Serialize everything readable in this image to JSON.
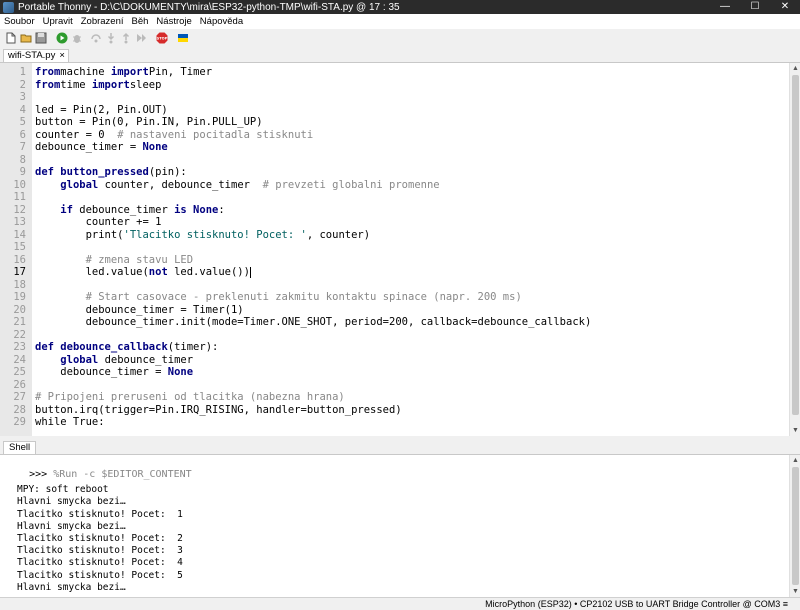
{
  "window": {
    "title": "Portable Thonny  -  D:\\C\\DOKUMENTY\\mira\\ESP32-python-TMP\\wifi-STA.py  @  17 : 35"
  },
  "window_buttons": {
    "minimize": "—",
    "maximize": "☐",
    "close": "✕"
  },
  "menu": [
    "Soubor",
    "Upravit",
    "Zobrazení",
    "Běh",
    "Nástroje",
    "Nápověda"
  ],
  "toolbar": {
    "icons": [
      "new-file-icon",
      "open-file-icon",
      "save-icon",
      "run-icon",
      "debug-icon",
      "step-over-icon",
      "step-into-icon",
      "step-out-icon",
      "resume-icon",
      "stop-icon",
      "ukraine-flag-icon"
    ],
    "colors": {
      "run": "#2e9b2e",
      "stop": "#d62b2b",
      "flag_blue": "#0057b7",
      "flag_yellow": "#ffd700"
    }
  },
  "editor": {
    "tab_label": "wifi-STA.py",
    "tab_close": "×",
    "current_line": 17,
    "line_numbers": [
      "1",
      "2",
      "3",
      "4",
      "5",
      "6",
      "7",
      "8",
      "9",
      "10",
      "11",
      "12",
      "13",
      "14",
      "15",
      "16",
      "17",
      "18",
      "19",
      "20",
      "21",
      "22",
      "23",
      "24",
      "25",
      "26",
      "27",
      "28",
      "29"
    ],
    "lines": [
      [
        [
          "kw",
          "from"
        ],
        [
          "",
          "machine "
        ],
        [
          "kw",
          "import"
        ],
        [
          "",
          "Pin, Timer"
        ]
      ],
      [
        [
          "kw",
          "from"
        ],
        [
          "",
          "time "
        ],
        [
          "kw",
          "import"
        ],
        [
          "",
          "sleep"
        ]
      ],
      [],
      [
        [
          "",
          "led = Pin(2, Pin.OUT)"
        ]
      ],
      [
        [
          "",
          "button = Pin(0, Pin.IN, Pin.PULL_UP)"
        ]
      ],
      [
        [
          "",
          "counter = 0  "
        ],
        [
          "cmt",
          "# nastaveni pocitadla stisknuti"
        ]
      ],
      [
        [
          "",
          "debounce_timer = "
        ],
        [
          "kw",
          "None"
        ]
      ],
      [],
      [
        [
          "kw",
          "def "
        ],
        [
          "kw",
          "button_pressed"
        ],
        [
          "",
          "(pin):"
        ]
      ],
      [
        [
          "",
          "    "
        ],
        [
          "kw",
          "global "
        ],
        [
          "",
          "counter, debounce_timer  "
        ],
        [
          "cmt",
          "# prevzeti globalni promenne"
        ]
      ],
      [],
      [
        [
          "",
          "    "
        ],
        [
          "kw",
          "if "
        ],
        [
          "",
          "debounce_timer "
        ],
        [
          "kw",
          "is None"
        ],
        [
          "",
          ":"
        ]
      ],
      [
        [
          "",
          "        counter += 1"
        ]
      ],
      [
        [
          "",
          "        print("
        ],
        [
          "str",
          "'Tlacitko stisknuto! Pocet: '"
        ],
        [
          "",
          ", counter)"
        ]
      ],
      [],
      [
        [
          "",
          "        "
        ],
        [
          "cmt",
          "# zmena stavu LED"
        ]
      ],
      [
        [
          "",
          "        led.value("
        ],
        [
          "kw",
          "not "
        ],
        [
          "",
          "led.value())"
        ],
        [
          "cursor",
          ""
        ]
      ],
      [],
      [
        [
          "",
          "        "
        ],
        [
          "cmt",
          "# Start casovace - preklenuti zakmitu kontaktu spinace (napr. 200 ms)"
        ]
      ],
      [
        [
          "",
          "        debounce_timer = Timer(1)"
        ]
      ],
      [
        [
          "",
          "        debounce_timer.init(mode=Timer.ONE_SHOT, period=200, callback=debounce_callback)"
        ]
      ],
      [],
      [
        [
          "kw",
          "def "
        ],
        [
          "kw",
          "debounce_callback"
        ],
        [
          "",
          "(timer):"
        ]
      ],
      [
        [
          "",
          "    "
        ],
        [
          "kw",
          "global "
        ],
        [
          "",
          "debounce_timer"
        ]
      ],
      [
        [
          "",
          "    debounce_timer = "
        ],
        [
          "kw",
          "None"
        ]
      ],
      [],
      [
        [
          "cmt",
          "# Pripojeni preruseni od tlacitka (nabezna hrana)"
        ]
      ],
      [
        [
          "",
          "button.irq(trigger=Pin.IRQ_RISING, handler=button_pressed)"
        ]
      ],
      [
        [
          "",
          "while True:"
        ]
      ]
    ]
  },
  "shell": {
    "tab_label": "Shell",
    "prompt": ">>> ",
    "command": "%Run -c $EDITOR_CONTENT",
    "output": [
      "",
      "MPY: soft reboot",
      "Hlavni smycka bezi…",
      "Tlacitko stisknuto! Pocet:  1",
      "Hlavni smycka bezi…",
      "Tlacitko stisknuto! Pocet:  2",
      "Tlacitko stisknuto! Pocet:  3",
      "Tlacitko stisknuto! Pocet:  4",
      "Tlacitko stisknuto! Pocet:  5",
      "Hlavni smycka bezi…"
    ]
  },
  "status": {
    "text": "MicroPython (ESP32)  •  CP2102 USB to UART Bridge Controller @ COM3  ≡"
  }
}
